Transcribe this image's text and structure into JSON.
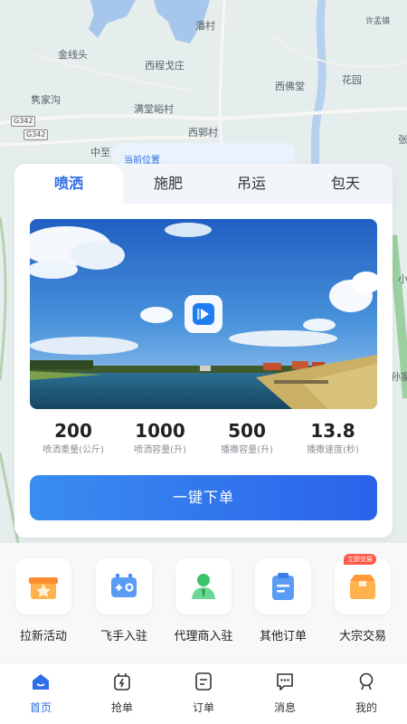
{
  "map": {
    "places": [
      "许孟镇",
      "潘村",
      "金线头",
      "西程戈庄",
      "西佛堂",
      "花园",
      "隽家沟",
      "满堂峪村",
      "西郭村",
      "中至",
      "张",
      "小",
      "孙家"
    ],
    "roads": [
      "G342",
      "G342"
    ]
  },
  "location_label": "当前位置",
  "tabs": [
    "喷洒",
    "施肥",
    "吊运",
    "包天"
  ],
  "active_tab": "喷洒",
  "video": {
    "icon": "play-icon"
  },
  "stats": [
    {
      "value": "200",
      "label": "喷洒重量(公斤)"
    },
    {
      "value": "1000",
      "label": "喷洒容量(升)"
    },
    {
      "value": "500",
      "label": "播撒容量(升)"
    },
    {
      "value": "13.8",
      "label": "播撒速度(秒)"
    }
  ],
  "order_button": "一键下单",
  "services": [
    {
      "label": "拉新活动",
      "icon": "gift-star-icon"
    },
    {
      "label": "飞手入驻",
      "icon": "battery-icon"
    },
    {
      "label": "代理商入驻",
      "icon": "agent-icon"
    },
    {
      "label": "其他订单",
      "icon": "clipboard-icon"
    },
    {
      "label": "大宗交易",
      "icon": "box-icon",
      "badge": "立即交易"
    }
  ],
  "nav": [
    {
      "label": "首页",
      "icon": "home-icon",
      "active": true
    },
    {
      "label": "抢单",
      "icon": "grab-order-icon"
    },
    {
      "label": "订单",
      "icon": "order-icon"
    },
    {
      "label": "消息",
      "icon": "message-icon"
    },
    {
      "label": "我的",
      "icon": "profile-icon"
    }
  ],
  "colors": {
    "accent": "#2e6ee6",
    "button_start": "#3a8df0",
    "button_end": "#2a62ea",
    "badge": "#ff5a4a"
  }
}
